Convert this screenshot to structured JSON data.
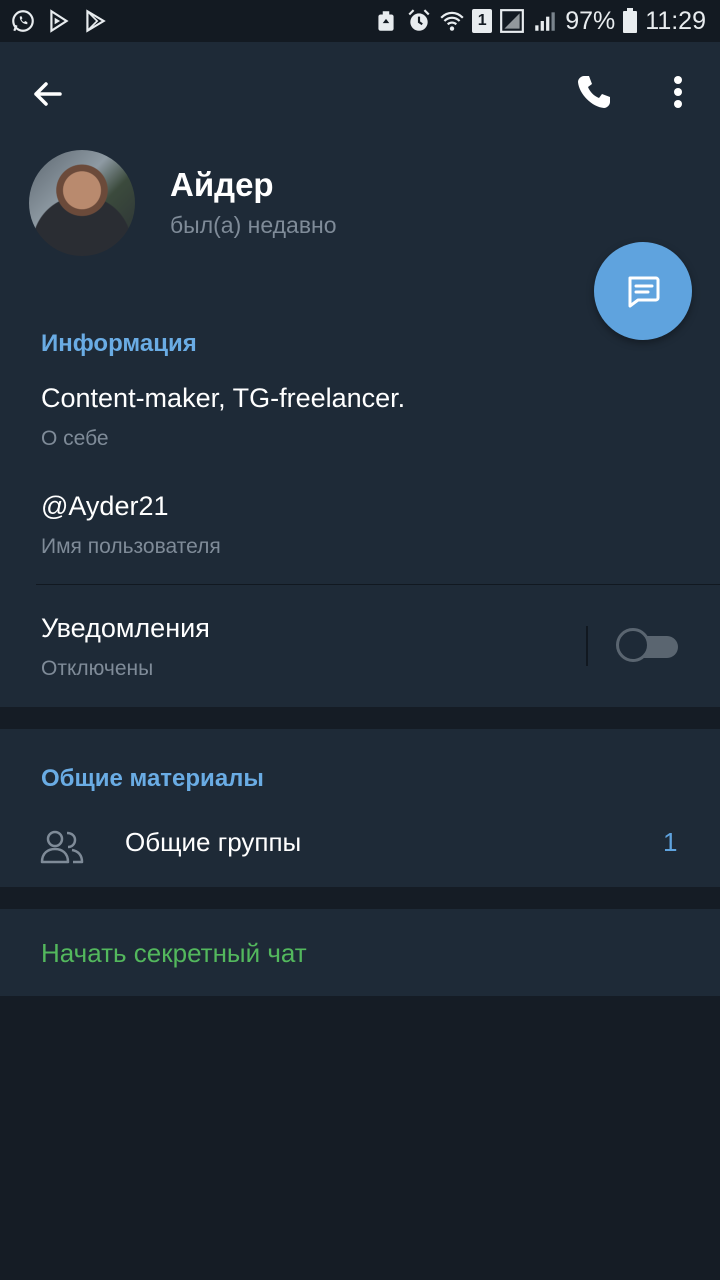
{
  "status_bar": {
    "battery_percent": "97%",
    "time": "11:29",
    "sim_badge": "1",
    "left_icons": [
      "whatsapp-icon",
      "play-services-icon",
      "play-store-icon"
    ],
    "right_icons": [
      "recycle-icon",
      "alarm-icon",
      "wifi-icon",
      "sim-icon",
      "signal-icon",
      "battery-icon"
    ]
  },
  "header": {
    "name": "Айдер",
    "last_seen": "был(а) недавно",
    "icons": {
      "back": "arrow-left-icon",
      "call": "phone-icon",
      "menu": "more-vertical-icon",
      "message": "message-icon"
    }
  },
  "info": {
    "title": "Информация",
    "bio": "Content-maker, TG-freelancer.",
    "bio_label": "О себе",
    "username": "@Ayder21",
    "username_label": "Имя пользователя",
    "notifications": "Уведомления",
    "notifications_status": "Отключены",
    "notifications_enabled": false
  },
  "shared": {
    "title": "Общие материалы",
    "groups_label": "Общие группы",
    "groups_count": "1"
  },
  "secret_chat": {
    "label": "Начать секретный чат"
  },
  "colors": {
    "background": "#151c25",
    "panel": "#1e2a37",
    "accent": "#6aace4",
    "fab": "#5fa3de",
    "green": "#53b85d",
    "secondary_text": "#7f8b98"
  }
}
